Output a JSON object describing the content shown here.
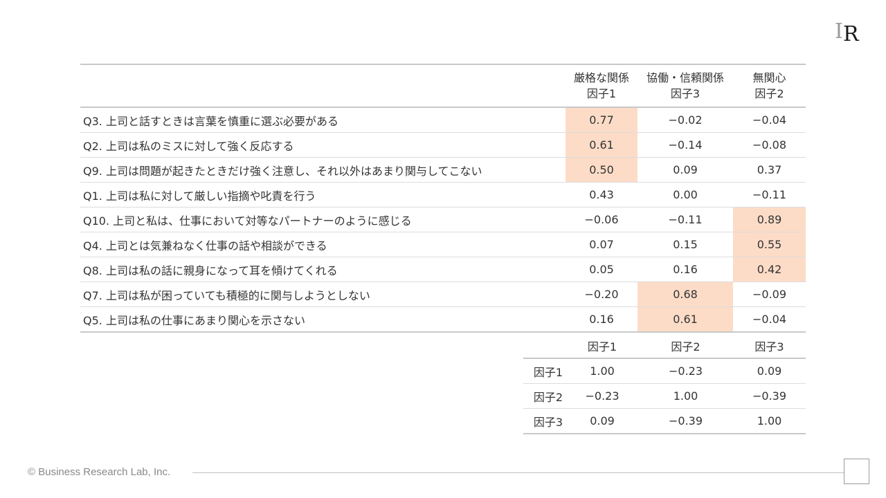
{
  "logo": {
    "letter1": "I",
    "letter2": "R"
  },
  "main_table": {
    "headers": [
      {
        "line1": "厳格な関係",
        "line2": "因子1"
      },
      {
        "line1": "協働・信頼関係",
        "line2": "因子3"
      },
      {
        "line1": "無関心",
        "line2": "因子2"
      }
    ],
    "rows": [
      {
        "question": "Q3. 上司と話すときは言葉を慎重に選ぶ必要がある",
        "values": [
          "0.77",
          "−0.02",
          "−0.04"
        ],
        "highlight": 0
      },
      {
        "question": "Q2. 上司は私のミスに対して強く反応する",
        "values": [
          "0.61",
          "−0.14",
          "−0.08"
        ],
        "highlight": 0
      },
      {
        "question": "Q9. 上司は問題が起きたときだけ強く注意し、それ以外はあまり関与してこない",
        "values": [
          "0.50",
          "0.09",
          "0.37"
        ],
        "highlight": 0
      },
      {
        "question": "Q1. 上司は私に対して厳しい指摘や叱責を行う",
        "values": [
          "0.43",
          "0.00",
          "−0.11"
        ],
        "highlight": null
      },
      {
        "question": "Q10. 上司と私は、仕事において対等なパートナーのように感じる",
        "values": [
          "−0.06",
          "−0.11",
          "0.89"
        ],
        "highlight": 2
      },
      {
        "question": "Q4. 上司とは気兼ねなく仕事の話や相談ができる",
        "values": [
          "0.07",
          "0.15",
          "0.55"
        ],
        "highlight": 2
      },
      {
        "question": "Q8. 上司は私の話に親身になって耳を傾けてくれる",
        "values": [
          "0.05",
          "0.16",
          "0.42"
        ],
        "highlight": 2
      },
      {
        "question": "Q7. 上司は私が困っていても積極的に関与しようとしない",
        "values": [
          "−0.20",
          "0.68",
          "−0.09"
        ],
        "highlight": 1
      },
      {
        "question": "Q5. 上司は私の仕事にあまり関心を示さない",
        "values": [
          "0.16",
          "0.61",
          "−0.04"
        ],
        "highlight": 1
      }
    ]
  },
  "correlation_table": {
    "headers": [
      "因子1",
      "因子2",
      "因子3"
    ],
    "rows": [
      {
        "label": "因子1",
        "values": [
          "1.00",
          "−0.23",
          "0.09"
        ]
      },
      {
        "label": "因子2",
        "values": [
          "−0.23",
          "1.00",
          "−0.39"
        ]
      },
      {
        "label": "因子3",
        "values": [
          "0.09",
          "−0.39",
          "1.00"
        ]
      }
    ]
  },
  "colors": {
    "highlight": "#fcdcc7",
    "rule": "#c8c8c8",
    "text": "#333333"
  },
  "footer": {
    "copyright": "© Business Research Lab, Inc."
  }
}
